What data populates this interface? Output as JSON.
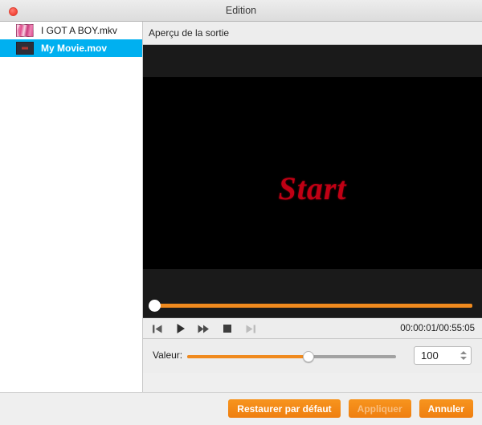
{
  "window": {
    "title": "Edition",
    "close_label": "×"
  },
  "sidebar": {
    "files": [
      {
        "name": "I GOT A BOY.mkv",
        "thumb": "pink-video-thumbnail",
        "selected": false
      },
      {
        "name": "My Movie.mov",
        "thumb": "dark-video-thumbnail",
        "selected": true
      }
    ]
  },
  "preview": {
    "header": "Aperçu de la sortie",
    "overlay_text": "Start",
    "timecode": "00:00:01/00:55:05",
    "timeline": {
      "position_percent": 0.5,
      "fill_color": "#f08a1e"
    },
    "transport": [
      {
        "name": "previous-button",
        "icon": "skip-previous-icon",
        "enabled": true
      },
      {
        "name": "play-button",
        "icon": "play-icon",
        "enabled": true
      },
      {
        "name": "fast-forward-button",
        "icon": "fast-forward-icon",
        "enabled": true
      },
      {
        "name": "stop-button",
        "icon": "stop-icon",
        "enabled": true
      },
      {
        "name": "next-button",
        "icon": "skip-next-icon",
        "enabled": false
      }
    ]
  },
  "value_control": {
    "label": "Valeur:",
    "slider_percent": 58,
    "input_value": "100"
  },
  "footer": {
    "restore_label": "Restaurer par défaut",
    "apply_label": "Appliquer",
    "cancel_label": "Annuler"
  },
  "colors": {
    "accent_orange": "#f08a1e",
    "selection_blue": "#00b0f0",
    "overlay_red": "#c00014",
    "close_red": "#f44336"
  }
}
